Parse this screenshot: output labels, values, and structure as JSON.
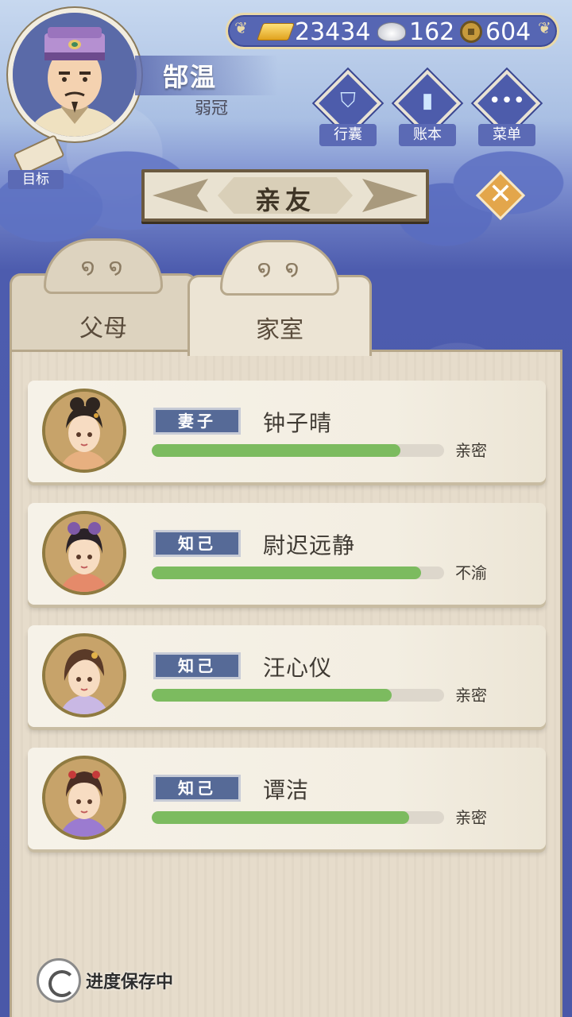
{
  "player": {
    "name": "郜温",
    "title": "弱冠"
  },
  "currency": {
    "gold": "23434",
    "silver": "162",
    "coins": "604"
  },
  "menu": [
    {
      "label": "行囊",
      "icon": "bag-icon"
    },
    {
      "label": "账本",
      "icon": "ledger-icon"
    },
    {
      "label": "菜单",
      "icon": "more-icon"
    }
  ],
  "goal_label": "目标",
  "page_title": "亲友",
  "tabs": {
    "parents": "父母",
    "household": "家室",
    "active": "household"
  },
  "relations": [
    {
      "tag": "妻子",
      "name": "钟子晴",
      "status": "亲密",
      "affinity": 0.85
    },
    {
      "tag": "知己",
      "name": "尉迟远静",
      "status": "不渝",
      "affinity": 0.92
    },
    {
      "tag": "知己",
      "name": "汪心仪",
      "status": "亲密",
      "affinity": 0.82
    },
    {
      "tag": "知己",
      "name": "谭洁",
      "status": "亲密",
      "affinity": 0.88
    }
  ],
  "save_status": "进度保存中",
  "colors": {
    "accent_blue": "#4f5fae",
    "bar_green": "#7cbb5f",
    "tag_blue": "#566a97",
    "gold": "#e3a64b"
  }
}
